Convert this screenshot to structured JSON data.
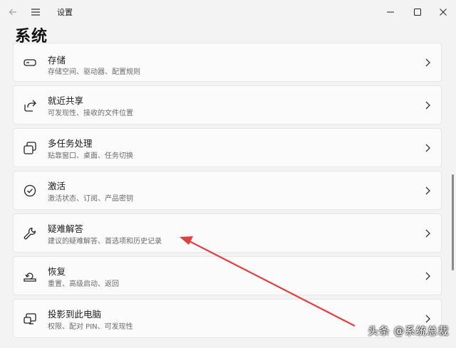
{
  "window": {
    "title": "设置"
  },
  "page": {
    "title": "系统"
  },
  "items": [
    {
      "name": "存储",
      "desc": "存储空间、驱动器、配置规则",
      "icon": "storage-icon"
    },
    {
      "name": "就近共享",
      "desc": "可发现性、接收的文件位置",
      "icon": "share-icon"
    },
    {
      "name": "多任务处理",
      "desc": "贴靠窗口、桌面、任务切换",
      "icon": "multitask-icon"
    },
    {
      "name": "激活",
      "desc": "激活状态、订阅、产品密钥",
      "icon": "activation-icon"
    },
    {
      "name": "疑难解答",
      "desc": "建议的疑难解答、首选项和历史记录",
      "icon": "wrench-icon"
    },
    {
      "name": "恢复",
      "desc": "重置、高级启动、返回",
      "icon": "recovery-icon"
    },
    {
      "name": "投影到此电脑",
      "desc": "权限、配对 PIN、可发现性",
      "icon": "projection-icon"
    }
  ],
  "annotation": {
    "color": "#e04040"
  },
  "watermark": {
    "text": "头条 @系统总裁"
  }
}
